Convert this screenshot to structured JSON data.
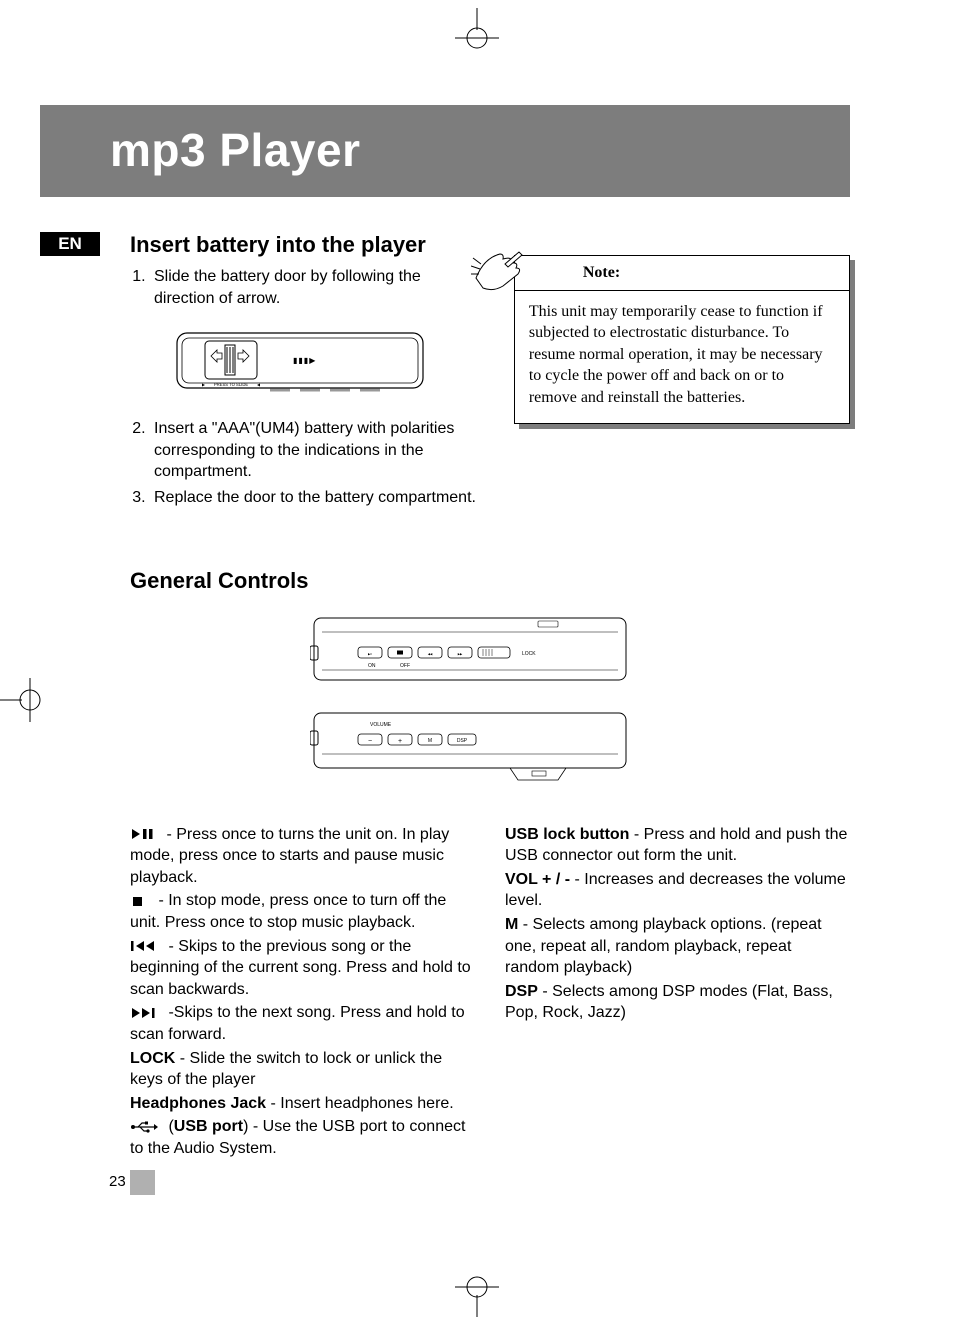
{
  "title": "mp3 Player",
  "lang_badge": "EN",
  "section1": {
    "heading": "Insert battery into the player",
    "steps": [
      "Slide the battery door by following the direction of arrow.",
      "Insert a \"AAA\"(UM4) battery with polarities corresponding to the indications in the compartment.",
      "Replace the door to the battery compartment."
    ]
  },
  "note": {
    "label": "Note:",
    "body": "This unit may temporarily cease to function if subjected to electrostatic disturbance. To resume normal operation, it may be necessary to cycle the power off and back on or to remove and reinstall the batteries."
  },
  "section2": {
    "heading": "General Controls"
  },
  "controls_left": {
    "play_pause": " - Press once to turns the unit on.  In play mode, press once to starts and pause music playback.",
    "stop": " - In stop mode, press once to turn off the unit. Press once to stop music playback.",
    "prev": " - Skips to the previous song or the beginning of the current song. Press and hold to scan backwards.",
    "next": " -Skips to the next song. Press and hold to scan forward.",
    "lock_label": "LOCK",
    "lock_text": " - Slide the switch to lock or unlick the keys of the player",
    "hp_label": "Headphones Jack",
    "hp_text": " - Insert headphones here.",
    "usb_port_label": "USB port",
    "usb_port_pre": "  (",
    "usb_port_text": ") - Use the USB port to connect to the Audio System."
  },
  "controls_right": {
    "usb_lock_label": "USB lock button",
    "usb_lock_text": " - Press and hold and push the USB connector out form the unit.",
    "vol_label": "VOL + / -",
    "vol_text": "  - Increases and decreases the volume level.",
    "m_label": "M",
    "m_text": " - Selects among playback options. (repeat one, repeat all, random playback, repeat random playback)",
    "dsp_label": "DSP",
    "dsp_text": " - Selects among DSP modes (Flat, Bass, Pop, Rock, Jazz)"
  },
  "device_labels": {
    "press_to_slide": "PRESS TO SLIDE",
    "lock": "LOCK",
    "on": "ON",
    "off": "OFF",
    "volume": "VOLUME",
    "minus": "−",
    "plus": "+",
    "m": "M",
    "dsp": "DSP"
  },
  "page_number": "23"
}
